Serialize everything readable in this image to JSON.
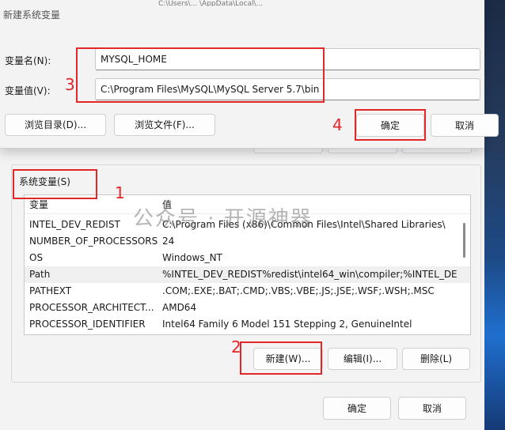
{
  "dialog": {
    "title": "新建系统变量",
    "top_strip_text": "C:\\Users\\... \\AppData\\Local\\...",
    "name_label": "变量名(N):",
    "name_value": "MYSQL_HOME",
    "value_label": "变量值(V):",
    "value_value": "C:\\Program Files\\MySQL\\MySQL Server 5.7\\bin",
    "browse_dir_label": "浏览目录(D)...",
    "browse_file_label": "浏览文件(F)...",
    "ok_label": "确定",
    "cancel_label": "取消"
  },
  "system_vars": {
    "group_title": "系统变量(S)",
    "columns": [
      "变量",
      "值"
    ],
    "rows": [
      {
        "name": "INTEL_DEV_REDIST",
        "value": "C:\\Program Files (x86)\\Common Files\\Intel\\Shared Libraries\\"
      },
      {
        "name": "NUMBER_OF_PROCESSORS",
        "value": "24"
      },
      {
        "name": "OS",
        "value": "Windows_NT"
      },
      {
        "name": "Path",
        "value": "%INTEL_DEV_REDIST%redist\\intel64_win\\compiler;%INTEL_DE..."
      },
      {
        "name": "PATHEXT",
        "value": ".COM;.EXE;.BAT;.CMD;.VBS;.VBE;.JS;.JSE;.WSF;.WSH;.MSC"
      },
      {
        "name": "PROCESSOR_ARCHITECT...",
        "value": "AMD64"
      },
      {
        "name": "PROCESSOR_IDENTIFIER",
        "value": "Intel64 Family 6 Model 151 Stepping 2, GenuineIntel"
      }
    ],
    "new_label": "新建(W)...",
    "edit_label": "编辑(I)...",
    "delete_label": "删除(L)"
  },
  "footer": {
    "ok_label": "确定",
    "cancel_label": "取消"
  },
  "annotations": {
    "marker_1": "1",
    "marker_2": "2",
    "marker_3": "3",
    "marker_4": "4",
    "color": "#e3262a"
  },
  "watermark": "公众号 · 开源神器"
}
